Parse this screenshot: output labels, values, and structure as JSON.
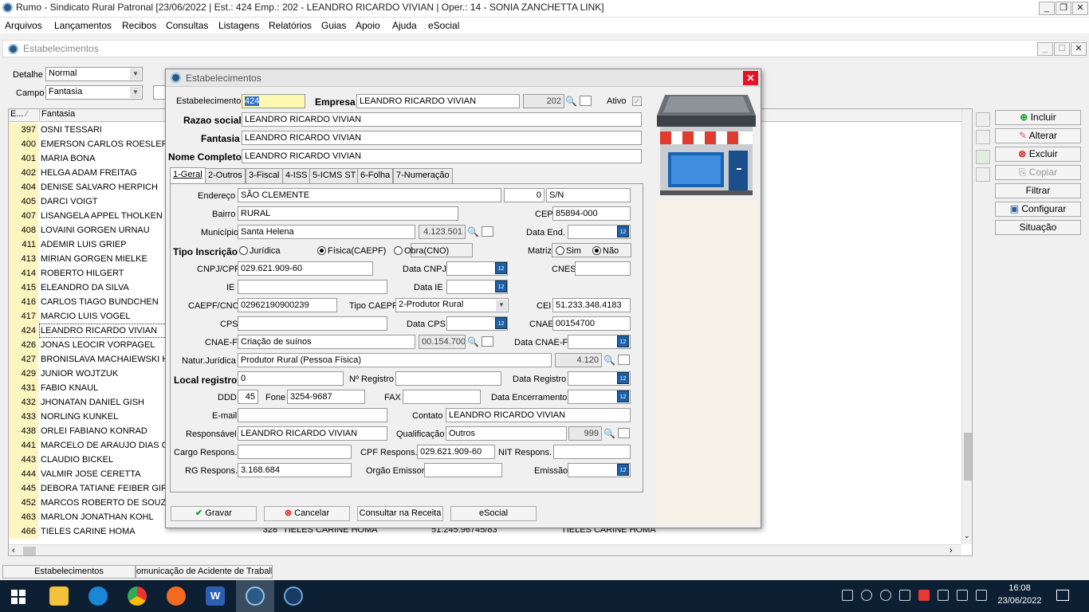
{
  "app": {
    "title": "Rumo - Sindicato Rural Patronal [23/06/2022 | Est.: 424 Emp.: 202 - LEANDRO RICARDO VIVIAN | Oper.: 14 - SONIA ZANCHETTA LINK]"
  },
  "menu": [
    "Arquivos",
    "Lançamentos",
    "Recibos",
    "Consultas",
    "Listagens",
    "Relatórios",
    "Guias",
    "Apoio",
    "Ajuda",
    "eSocial"
  ],
  "child": {
    "title": "Estabelecimentos"
  },
  "filters": {
    "detalhe_label": "Detalhe",
    "detalhe_value": "Normal",
    "campo_label": "Campo",
    "campo_value": "Fantasia"
  },
  "grid": {
    "col1": "E...",
    "col2": "Fantasia",
    "rows": [
      [
        "397",
        "OSNI TESSARI"
      ],
      [
        "400",
        "EMERSON CARLOS ROESLER"
      ],
      [
        "401",
        "MARIA BONA"
      ],
      [
        "402",
        "HELGA ADAM FREITAG"
      ],
      [
        "404",
        "DENISE SALVARO HERPICH"
      ],
      [
        "405",
        "DARCI VOIGT"
      ],
      [
        "407",
        "LISANGELA APPEL THOLKEN"
      ],
      [
        "408",
        "LOVAINI GORGEN URNAU"
      ],
      [
        "411",
        "ADEMIR LUIS GRIEP"
      ],
      [
        "413",
        "MIRIAN GORGEN MIELKE"
      ],
      [
        "414",
        "ROBERTO HILGERT"
      ],
      [
        "415",
        "ELEANDRO DA SILVA"
      ],
      [
        "416",
        "CARLOS TIAGO BUNDCHEN"
      ],
      [
        "417",
        "MARCIO LUIS VOGEL"
      ],
      [
        "424",
        "LEANDRO RICARDO VIVIAN"
      ],
      [
        "426",
        "JONAS LEOCIR VORPAGEL"
      ],
      [
        "427",
        "BRONISLAVA MACHAIEWSKI HU"
      ],
      [
        "429",
        "JUNIOR WOJTZUK"
      ],
      [
        "431",
        "FABIO KNAUL"
      ],
      [
        "432",
        "JHONATAN DANIEL GISH"
      ],
      [
        "433",
        "NORLING KUNKEL"
      ],
      [
        "438",
        "ORLEI FABIANO KONRAD"
      ],
      [
        "441",
        "MARCELO DE ARAUJO DIAS CAF"
      ],
      [
        "443",
        "CLAUDIO BICKEL"
      ],
      [
        "444",
        "VALMIR JOSE CERETTA"
      ],
      [
        "445",
        "DEBORA TATIANE FEIBER GIRAR"
      ],
      [
        "452",
        "MARCOS ROBERTO DE SOUZA"
      ],
      [
        "463",
        "MARLON JONATHAN KOHL"
      ],
      [
        "466",
        "TIELES CARINE HOMA"
      ]
    ],
    "last_row_extra": {
      "code": "328",
      "name": "TIELES CARINE HOMA",
      "doc": "51.245.96745/83",
      "contact": "TIELES CARINE HOMA"
    }
  },
  "side": {
    "incluir": "Incluir",
    "alterar": "Alterar",
    "excluir": "Excluir",
    "copiar": "Copiar",
    "filtrar": "Filtrar",
    "configurar": "Configurar",
    "situacao": "Situação"
  },
  "dialog": {
    "title": "Estabelecimentos",
    "estab_label": "Estabelecimento",
    "estab_value": "424",
    "empresa_label": "Empresa",
    "empresa_value": "LEANDRO RICARDO VIVIAN",
    "empresa_code": "202",
    "ativo_label": "Ativo",
    "razao_label": "Razao social",
    "razao_value": "LEANDRO RICARDO VIVIAN",
    "fantasia_label": "Fantasia",
    "fantasia_value": "LEANDRO RICARDO VIVIAN",
    "nome_label": "Nome Completo",
    "nome_value": "LEANDRO RICARDO VIVIAN",
    "tabs": [
      "1-Geral",
      "2-Outros",
      "3-Fiscal",
      "4-ISS",
      "5-ICMS ST",
      "6-Folha",
      "7-Numeração"
    ],
    "endereco_label": "Endereço",
    "endereco_value": "SÃO CLEMENTE",
    "numero_value": "0",
    "compl_value": "S/N",
    "bairro_label": "Bairro",
    "bairro_value": "RURAL",
    "cep_label": "CEP",
    "cep_value": "85894-000",
    "municipio_label": "Município",
    "municipio_value": "Santa Helena",
    "municipio_code": "4.123.501",
    "dataend_label": "Data End.",
    "tipoinsc_label": "Tipo Inscrição",
    "tipo_opts": [
      "Jurídica",
      "Física(CAEPF)",
      "Obra(CNO)"
    ],
    "matriz_label": "Matriz",
    "matriz_opts": [
      "Sim",
      "Não"
    ],
    "cnpj_label": "CNPJ/CPF",
    "cnpj_value": "029.621.909-60",
    "datacnpj_label": "Data CNPJ",
    "cnes_label": "CNES",
    "ie_label": "IE",
    "dataie_label": "Data IE",
    "caepf_label": "CAEPF/CNO",
    "caepf_value": "02962190900239",
    "tipocaepf_label": "Tipo CAEPF",
    "tipocaepf_value": "2-Produtor Rural",
    "cei_label": "CEI",
    "cei_value": "51.233.348.4183",
    "cps_label": "CPS",
    "datacps_label": "Data CPS",
    "cnae_label": "CNAE",
    "cnae_value": "00154700",
    "cnaef_label": "CNAE-F",
    "cnaef_value": "Criação de suínos",
    "cnaef_code": "00.154.700",
    "datacnaef_label": "Data CNAE-F",
    "natjur_label": "Natur.Jurídica",
    "natjur_value": "Produtor Rural (Pessoa Física)",
    "natjur_code": "4.120",
    "localreg_label": "Local registro",
    "localreg_value": "0",
    "nreg_label": "Nº Registro",
    "datareg_label": "Data Registro",
    "ddd_label": "DDD",
    "ddd_value": "45",
    "fone_label": "Fone",
    "fone_value": "3254-9687",
    "fax_label": "FAX",
    "dataenc_label": "Data Encerramento",
    "email_label": "E-mail",
    "contato_label": "Contato",
    "contato_value": "LEANDRO RICARDO VIVIAN",
    "resp_label": "Responsável",
    "resp_value": "LEANDRO RICARDO VIVIAN",
    "qualif_label": "Qualificação",
    "qualif_value": "Outros",
    "qualif_code": "999",
    "cargo_label": "Cargo Respons.",
    "cpfresp_label": "CPF Respons.",
    "cpfresp_value": "029.621.909-60",
    "nitresp_label": "NIT Respons.",
    "rgresp_label": "RG Respons.",
    "rgresp_value": "3.168.684",
    "orgao_label": "Orgão Emissor",
    "emissao_label": "Emissão",
    "btn_gravar": "Gravar",
    "btn_cancelar": "Cancelar",
    "btn_consultar": "Consultar na Receita",
    "btn_esocial": "eSocial"
  },
  "tabsbottom": [
    "Estabelecimentos",
    "omunicação de Acidente de Trabalh"
  ],
  "clock": {
    "time": "16:08",
    "date": "23/06/2022"
  }
}
